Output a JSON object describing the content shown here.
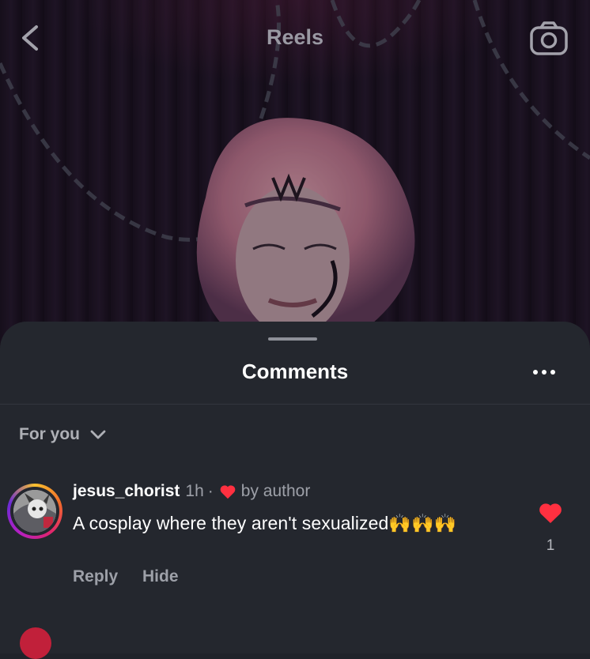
{
  "header": {
    "title": "Reels",
    "back_icon": "chevron-left-icon",
    "camera_icon": "camera-icon"
  },
  "sheet": {
    "title": "Comments",
    "more_icon": "more-horizontal-icon",
    "sort": {
      "label": "For you",
      "icon": "chevron-down-icon"
    }
  },
  "comments": [
    {
      "username": "jesus_chorist",
      "time": "1h",
      "separator": "·",
      "liked_by_author_label": "by author",
      "text": "A cosplay where they aren't sexualized🙌🙌🙌",
      "like_count": "1",
      "liked": true,
      "reply_label": "Reply",
      "hide_label": "Hide"
    }
  ],
  "colors": {
    "sheet_bg": "#24272e",
    "like_red": "#ff3040",
    "muted_text": "#9da0a8"
  }
}
